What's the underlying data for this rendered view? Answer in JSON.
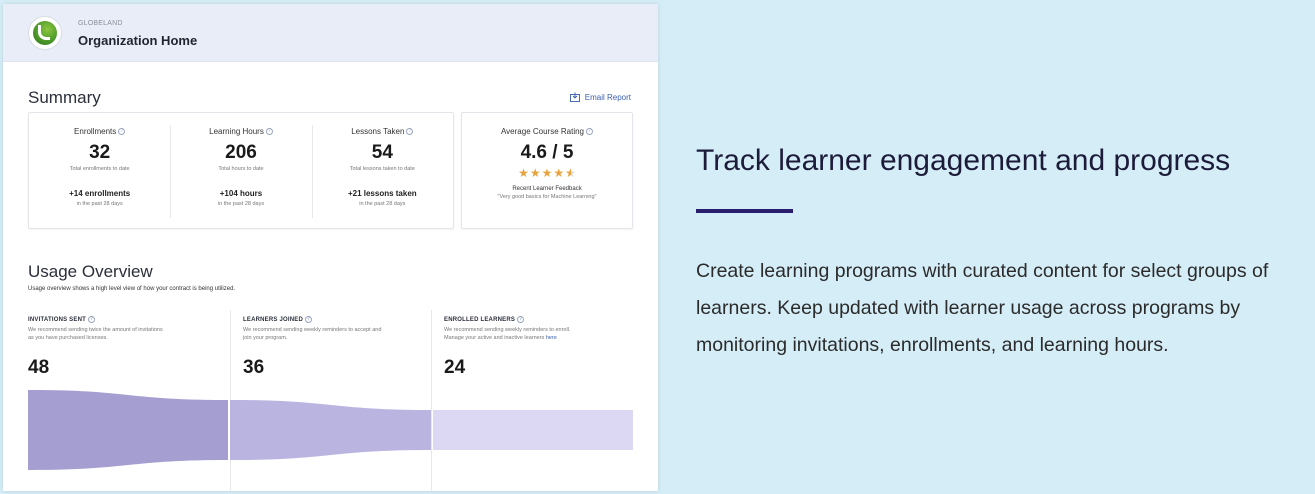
{
  "header": {
    "org_eyebrow": "GLOBELAND",
    "org_title": "Organization Home",
    "logo_icon": "globeland-logo-icon"
  },
  "summary": {
    "title": "Summary",
    "email_report_label": "Email Report",
    "email_report_icon": "download-icon",
    "stats": [
      {
        "label": "Enrollments",
        "value": "32",
        "sub": "Total enrollments to date",
        "delta": "+14 enrollments",
        "delta_sub": "in the past 28 days"
      },
      {
        "label": "Learning Hours",
        "value": "206",
        "sub": "Total hours to date",
        "delta": "+104 hours",
        "delta_sub": "in the past 28 days"
      },
      {
        "label": "Lessons Taken",
        "value": "54",
        "sub": "Total lessons taken to date",
        "delta": "+21 lessons taken",
        "delta_sub": "in the past 28 days"
      }
    ],
    "rating": {
      "label": "Average Course Rating",
      "value": "4.6 / 5",
      "stars": 4.5,
      "feedback_label": "Recent Learner Feedback",
      "feedback_quote": "\"Very good basics for Machine Learning\""
    }
  },
  "usage": {
    "title": "Usage Overview",
    "description": "Usage overview shows a high level view of how your contract is being utilized.",
    "columns": [
      {
        "head": "INVITATIONS SENT",
        "note": "We recommend sending twice the amount of invitations as you have purchased licenses.",
        "value": "48",
        "color": "#a59fd1"
      },
      {
        "head": "LEARNERS JOINED",
        "note": "We recommend sending weekly reminders to accept and join your program.",
        "value": "36",
        "color": "#bab5e0"
      },
      {
        "head": "ENROLLED LEARNERS",
        "note": "We recommend sending weekly reminders to enroll. Manage your active and inactive learners",
        "link": "here",
        "value": "24",
        "color": "#dcd8f3"
      }
    ]
  },
  "marketing": {
    "title": "Track learner engagement and progress",
    "accent_color": "#2b1d6e",
    "body": "Create learning programs with curated content for select groups of learners. Keep updated with learner usage across programs by monitoring invitations, enrollments, and learning hours."
  }
}
